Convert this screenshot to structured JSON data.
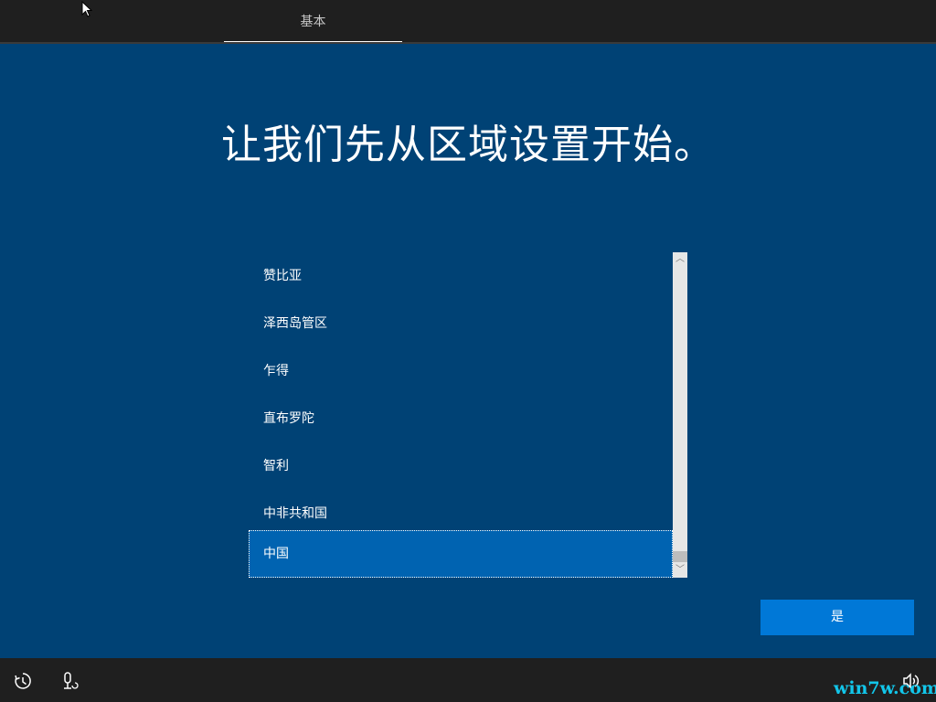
{
  "header": {
    "tab_label": "基本"
  },
  "main": {
    "headline": "让我们先从区域设置开始。",
    "regions": [
      "赞比亚",
      "泽西岛管区",
      "乍得",
      "直布罗陀",
      "智利",
      "中非共和国",
      "中国"
    ],
    "selected_region": "中国",
    "scroll_up_glyph": "︿",
    "scroll_down_glyph": "﹀",
    "yes_button_label": "是"
  },
  "footer": {
    "watermark": "win7w.com",
    "icons": [
      "ease-of-access-icon",
      "microphone-icon",
      "volume-icon"
    ]
  },
  "colors": {
    "background": "#004275",
    "bar": "#1f1f1f",
    "selected_item": "#0063b1",
    "button": "#0078d7",
    "watermark": "#12c6ea"
  }
}
